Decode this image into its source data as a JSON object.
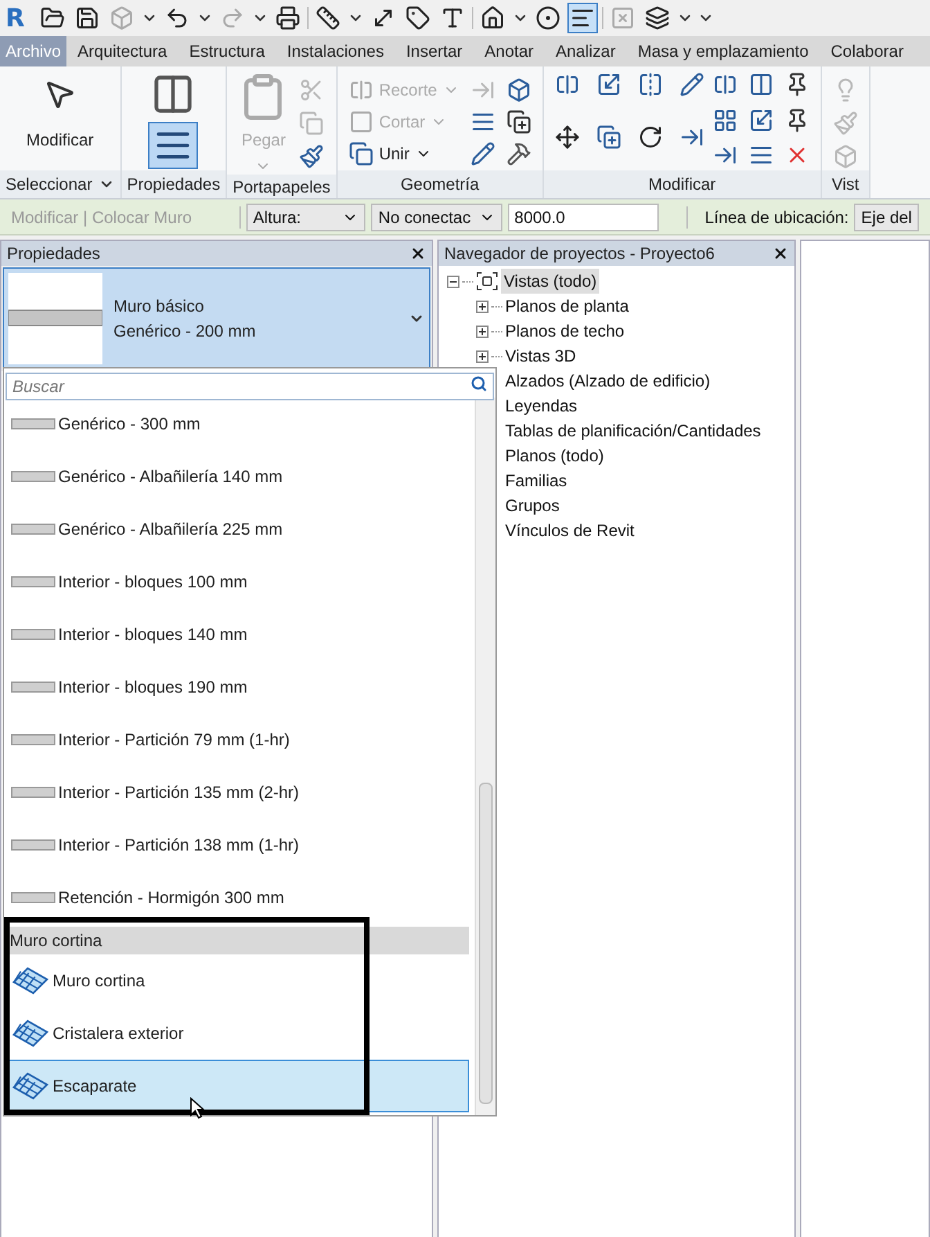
{
  "app_logo": "R",
  "quick_access": {
    "thin_lines_on": true
  },
  "ribbon_tabs": [
    {
      "label": "Archivo",
      "kind": "application"
    },
    {
      "label": "Arquitectura",
      "kind": "tab"
    },
    {
      "label": "Estructura",
      "kind": "tab"
    },
    {
      "label": "Instalaciones",
      "kind": "tab"
    },
    {
      "label": "Insertar",
      "kind": "tab"
    },
    {
      "label": "Anotar",
      "kind": "tab"
    },
    {
      "label": "Analizar",
      "kind": "tab"
    },
    {
      "label": "Masa y emplazamiento",
      "kind": "tab"
    },
    {
      "label": "Colaborar",
      "kind": "tab"
    }
  ],
  "ribbon_panels": [
    {
      "kind": "select",
      "label": "Seleccionar",
      "tools": [
        {
          "label": "Modificar",
          "disabled": false
        }
      ]
    },
    {
      "kind": "properties",
      "label": "Propiedades",
      "pressed": true
    },
    {
      "kind": "clipboard",
      "label": "Portapapeles",
      "tools": [
        {
          "label": "Pegar",
          "disabled": true
        }
      ]
    },
    {
      "kind": "geometry",
      "label": "Geometría",
      "tools": [
        {
          "label": "Recorte",
          "disabled": true
        },
        {
          "label": "Cortar",
          "disabled": true
        },
        {
          "label": "Unir",
          "disabled": false
        }
      ]
    },
    {
      "kind": "modify",
      "label": "Modificar"
    },
    {
      "kind": "view",
      "label": "Vist"
    }
  ],
  "options_bar": {
    "context": "Modificar | Colocar Muro",
    "height_mode": "Altura:",
    "constraint": "No conectac",
    "height_value": "8000.0",
    "location_label": "Línea de ubicación:",
    "location_value": "Eje del"
  },
  "properties": {
    "title": "Propiedades",
    "type_family": "Muro básico",
    "type_name": "Genérico - 200 mm"
  },
  "type_dropdown": {
    "search_placeholder": "Buscar",
    "items": [
      {
        "kind": "wall",
        "label": "Genérico - 300 mm",
        "selected": false
      },
      {
        "kind": "wall",
        "label": "Genérico - Albañilería 140 mm",
        "selected": false
      },
      {
        "kind": "wall",
        "label": "Genérico - Albañilería 225 mm",
        "selected": false
      },
      {
        "kind": "wall",
        "label": "Interior - bloques 100 mm",
        "selected": false
      },
      {
        "kind": "wall",
        "label": "Interior - bloques 140 mm",
        "selected": false
      },
      {
        "kind": "wall",
        "label": "Interior - bloques 190 mm",
        "selected": false
      },
      {
        "kind": "wall",
        "label": "Interior - Partición 79 mm (1-hr)",
        "selected": false
      },
      {
        "kind": "wall",
        "label": "Interior - Partición 135 mm (2-hr)",
        "selected": false
      },
      {
        "kind": "wall",
        "label": "Interior - Partición 138 mm (1-hr)",
        "selected": false
      },
      {
        "kind": "wall",
        "label": "Retención - Hormigón 300 mm",
        "selected": false
      },
      {
        "kind": "header",
        "label": "Muro cortina"
      },
      {
        "kind": "curtain",
        "label": "Muro cortina",
        "selected": false
      },
      {
        "kind": "curtain",
        "label": "Cristalera exterior",
        "selected": false
      },
      {
        "kind": "curtain",
        "label": "Escaparate",
        "selected": true
      }
    ]
  },
  "project_browser": {
    "title": "Navegador de proyectos - Proyecto6",
    "tree": [
      {
        "label": "Vistas (todo)",
        "selected": true,
        "expanded": true,
        "children": [
          {
            "label": "Planos de planta",
            "selected": false,
            "expanded": false
          },
          {
            "label": "Planos de techo",
            "selected": false,
            "expanded": false
          },
          {
            "label": "Vistas 3D",
            "selected": false,
            "expanded": false
          },
          {
            "label": "Alzados (Alzado de edificio)",
            "selected": false
          }
        ]
      },
      {
        "label": "Leyendas",
        "selected": false
      },
      {
        "label": "Tablas de planificación/Cantidades",
        "selected": false
      },
      {
        "label": "Planos (todo)",
        "selected": false
      },
      {
        "label": "Familias",
        "selected": false
      },
      {
        "label": "Grupos",
        "selected": false
      },
      {
        "label": "Vínculos de Revit",
        "selected": false
      }
    ]
  }
}
